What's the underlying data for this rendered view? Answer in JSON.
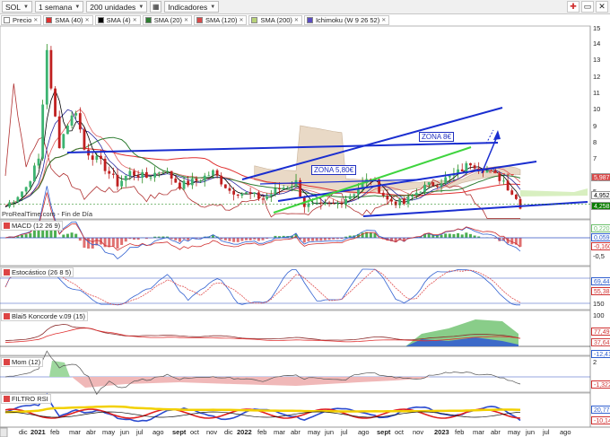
{
  "toolbar": {
    "symbol": "SOL",
    "period": "1 semana",
    "units": "200 unidades",
    "indicators": "Indicadores"
  },
  "legend": [
    {
      "label": "Precio",
      "color": "#ffffff"
    },
    {
      "label": "SMA (40)",
      "color": "#e03030"
    },
    {
      "label": "SMA (4)",
      "color": "#000000"
    },
    {
      "label": "SMA (20)",
      "color": "#2e7d32"
    },
    {
      "label": "SMA (120)",
      "color": "#d84a4a"
    },
    {
      "label": "SMA (200)",
      "color": "#b8d27a"
    },
    {
      "label": "Ichimoku (W 9 26 52)",
      "color": "#5a4cc0"
    }
  ],
  "source_label": "ProRealTime.com - Fin de Día",
  "annotations": {
    "zone_8": "ZONA 8€",
    "zone_58": "ZONA 5,80€"
  },
  "price_axis": [
    "15",
    "14",
    "13",
    "12",
    "11",
    "10",
    "9",
    "8",
    "7",
    "6",
    "5"
  ],
  "price_tags": [
    {
      "text": "5,987",
      "color": "#d84a4a"
    },
    {
      "text": "4,952",
      "color": "#ffffff"
    },
    {
      "text": "4,258",
      "color": "#0a7d00"
    }
  ],
  "panels": [
    {
      "title": "MACD (12 26 9)",
      "axis": [
        "0",
        "-0,5"
      ],
      "tags": [
        {
          "text": "0,220",
          "color": "#6cc06c"
        },
        {
          "text": "0,059",
          "color": "#3060d0"
        },
        {
          "text": "-0,160",
          "color": "#d03030"
        }
      ]
    },
    {
      "title": "Estocástico (26 8 5)",
      "axis": [],
      "tags": [
        {
          "text": "69,44",
          "color": "#3060d0"
        },
        {
          "text": "55,38",
          "color": "#d03030"
        }
      ]
    },
    {
      "title": "Blai5 Koncorde v.09 (15)",
      "axis": [
        "150",
        "100",
        "50"
      ],
      "tags": [
        {
          "text": "77,49",
          "color": "#d03030"
        },
        {
          "text": "37,64",
          "color": "#d04040"
        },
        {
          "text": "-12,41",
          "color": "#3060d0"
        }
      ]
    },
    {
      "title": "Mom (12)",
      "axis": [
        "2"
      ],
      "tags": [
        {
          "text": "-1,322",
          "color": "#d03030"
        }
      ]
    },
    {
      "title": "FILTRO RSI",
      "axis": [],
      "tags": [
        {
          "text": "20,77",
          "color": "#3060d0"
        },
        {
          "text": "-10,14",
          "color": "#d03030"
        }
      ]
    }
  ],
  "time_axis": [
    "dic",
    "2021",
    "feb",
    "mar",
    "abr",
    "may",
    "jun",
    "jul",
    "ago",
    "sept",
    "oct",
    "nov",
    "dic",
    "2022",
    "feb",
    "mar",
    "abr",
    "may",
    "jun",
    "jul",
    "ago",
    "sept",
    "oct",
    "nov",
    "2023",
    "feb",
    "mar",
    "abr",
    "may",
    "jun",
    "jul",
    "ago"
  ]
}
